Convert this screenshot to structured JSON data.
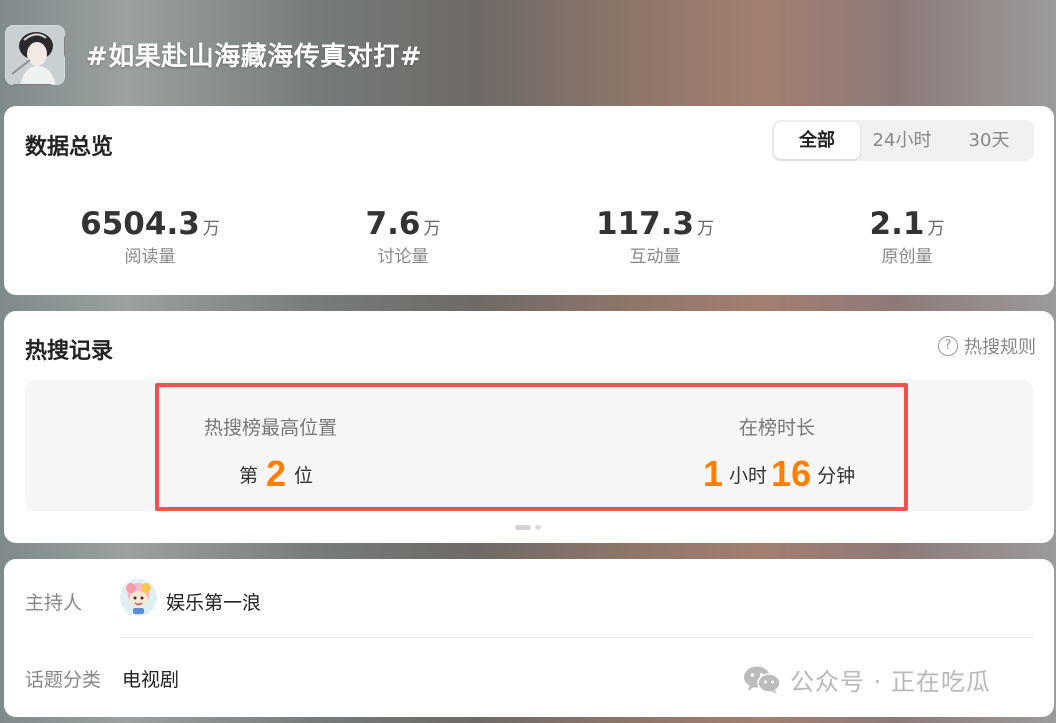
{
  "header": {
    "title": "#如果赴山海藏海传真对打#",
    "cover_icon": "drama-cover-thumbnail"
  },
  "overview": {
    "title": "数据总览",
    "tabs": [
      {
        "label": "全部",
        "active": true
      },
      {
        "label": "24小时",
        "active": false
      },
      {
        "label": "30天",
        "active": false
      }
    ],
    "stats": [
      {
        "value": "6504.3",
        "unit": "万",
        "label": "阅读量"
      },
      {
        "value": "7.6",
        "unit": "万",
        "label": "讨论量"
      },
      {
        "value": "117.3",
        "unit": "万",
        "label": "互动量"
      },
      {
        "value": "2.1",
        "unit": "万",
        "label": "原创量"
      }
    ]
  },
  "hot_search": {
    "title": "热搜记录",
    "rules_label": "热搜规则",
    "peak": {
      "label": "热搜榜最高位置",
      "prefix": "第",
      "rank": "2",
      "suffix": "位"
    },
    "duration": {
      "label": "在榜时长",
      "hours": "1",
      "hours_unit": "小时",
      "minutes": "16",
      "minutes_unit": "分钟"
    },
    "highlight_color": "#f15151",
    "accent_color": "#ff7f00"
  },
  "info": {
    "host_label": "主持人",
    "host_name": "娱乐第一浪",
    "category_label": "话题分类",
    "category_value": "电视剧"
  },
  "watermark": {
    "text": "公众号 · 正在吃瓜",
    "icon": "wechat-icon"
  }
}
